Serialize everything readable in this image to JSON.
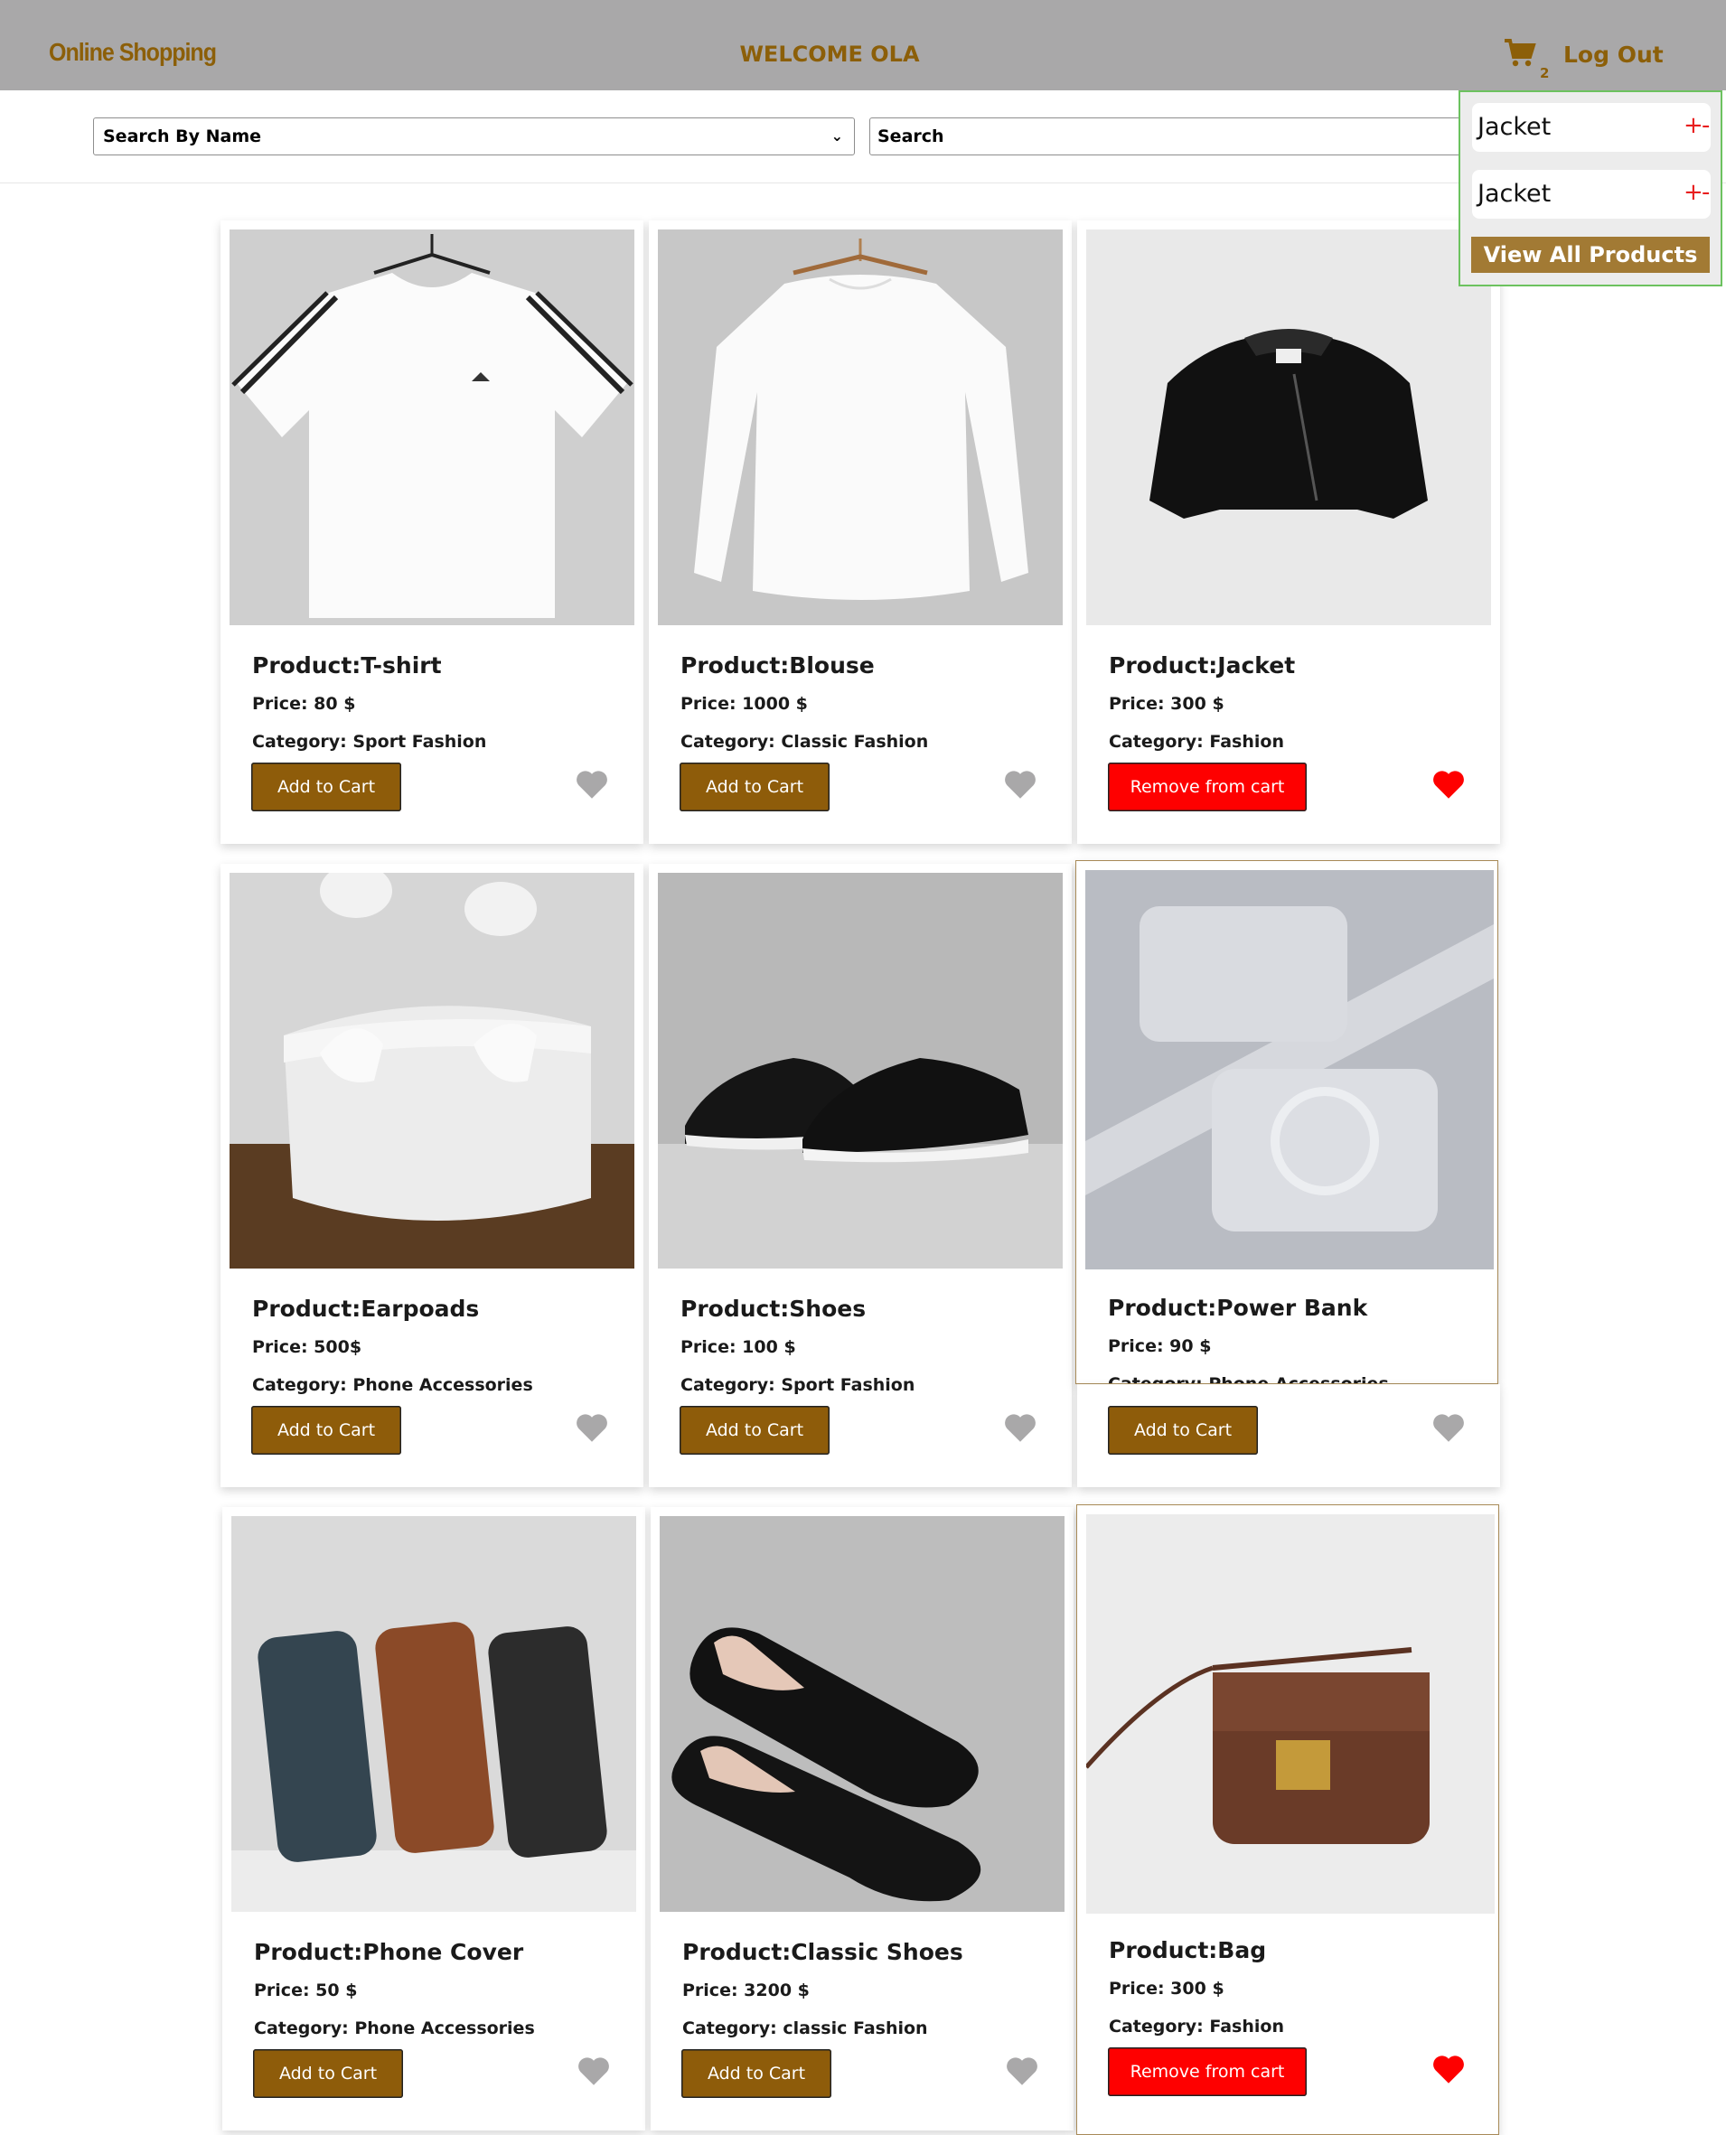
{
  "header": {
    "brand": "Online Shopping",
    "welcome": "WELCOME OLA",
    "cart_count": "2",
    "logout_label": "Log Out"
  },
  "filters": {
    "select_value": "Search By Name",
    "search_placeholder": "Search"
  },
  "cart_dropdown": {
    "items": [
      {
        "name": "Jacket",
        "plus": "+",
        "minus": "-"
      },
      {
        "name": "Jacket",
        "plus": "+",
        "minus": "-"
      }
    ],
    "view_all_label": "View All Products"
  },
  "products": [
    {
      "title": "Product:T-shirt",
      "price": "Price: 80 $",
      "category": "Category: Sport Fashion",
      "button": "Add to Cart",
      "in_cart": false
    },
    {
      "title": "Product:Blouse",
      "price": "Price: 1000 $",
      "category": "Category: Classic Fashion",
      "button": "Add to Cart",
      "in_cart": false
    },
    {
      "title": "Product:Jacket",
      "price": "Price: 300 $",
      "category": "Category: Fashion",
      "button": "Remove from cart",
      "in_cart": true
    },
    {
      "title": "Product:Earpoads",
      "price": "Price: 500$",
      "category": "Category: Phone Accessories",
      "button": "Add to Cart",
      "in_cart": false
    },
    {
      "title": "Product:Shoes",
      "price": "Price: 100 $",
      "category": "Category: Sport Fashion",
      "button": "Add to Cart",
      "in_cart": false
    },
    {
      "title": "Product:Power Bank",
      "price": "Price: 90 $",
      "category": "Category: Phone Accessories",
      "button": "Add to Cart",
      "in_cart": false
    },
    {
      "title": "Product:Phone Cover",
      "price": "Price: 50 $",
      "category": "Category: Phone Accessories",
      "button": "Add to Cart",
      "in_cart": false
    },
    {
      "title": "Product:Classic Shoes",
      "price": "Price: 3200 $",
      "category": "Category: classic Fashion",
      "button": "Add to Cart",
      "in_cart": false
    },
    {
      "title": "Product:Bag",
      "price": "Price: 300 $",
      "category": "Category: Fashion",
      "button": "Remove from cart",
      "in_cart": true
    }
  ],
  "colors": {
    "accent": "#8e5c0a",
    "remove": "#fe0000",
    "heart_active": "#fe0000",
    "heart_inactive": "#a9a8a9",
    "topbar": "#a9a8a9"
  }
}
